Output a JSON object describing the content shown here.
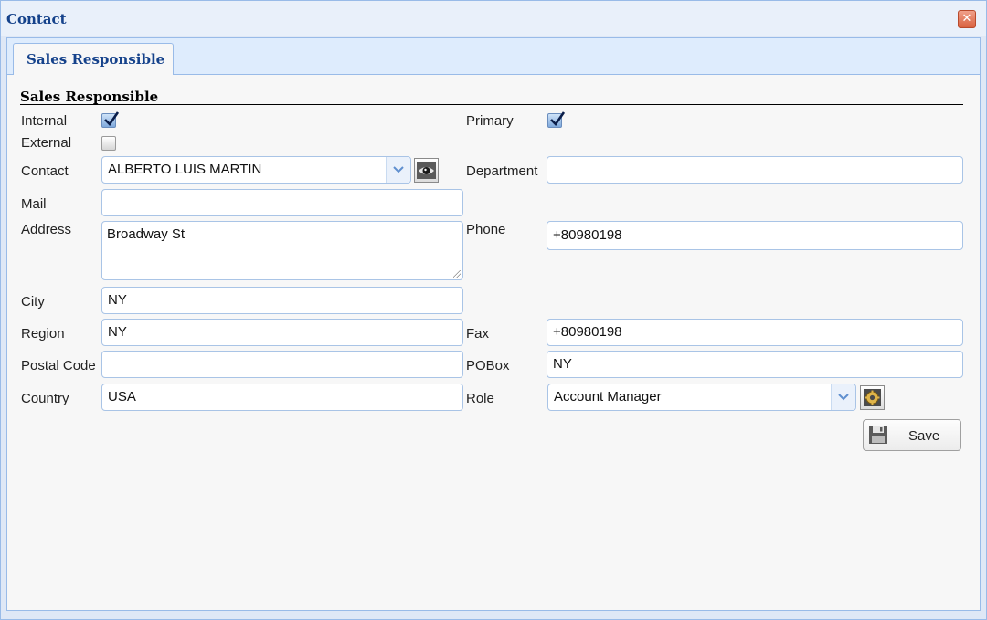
{
  "window": {
    "title": "Contact",
    "close_icon": "close-icon"
  },
  "tabs": [
    {
      "label": "Sales Responsible",
      "active": true
    }
  ],
  "section": {
    "title": "Sales Responsible"
  },
  "form": {
    "internal": {
      "label": "Internal",
      "checked": true
    },
    "external": {
      "label": "External",
      "checked": false
    },
    "primary": {
      "label": "Primary",
      "checked": true
    },
    "contact": {
      "label": "Contact",
      "value": "ALBERTO LUIS MARTIN",
      "action_icon": "eye-icon"
    },
    "department": {
      "label": "Department",
      "value": ""
    },
    "mail": {
      "label": "Mail",
      "value": ""
    },
    "address": {
      "label": "Address",
      "value": "Broadway St"
    },
    "phone": {
      "label": "Phone",
      "value": "+80980198"
    },
    "city": {
      "label": "City",
      "value": "NY"
    },
    "region": {
      "label": "Region",
      "value": "NY"
    },
    "fax": {
      "label": "Fax",
      "value": "+80980198"
    },
    "postal_code": {
      "label": "Postal Code",
      "value": ""
    },
    "pobox": {
      "label": "POBox",
      "value": "NY"
    },
    "country": {
      "label": "Country",
      "value": "USA"
    },
    "role": {
      "label": "Role",
      "value": "Account Manager",
      "action_icon": "settings-icon"
    }
  },
  "actions": {
    "save_label": "Save",
    "save_icon": "floppy-disk-icon"
  },
  "colors": {
    "title_blue": "#15428b",
    "border_blue": "#99bbe8",
    "tab_strip": "#deecfd",
    "checkbox_blue": "#7fa9dc"
  }
}
